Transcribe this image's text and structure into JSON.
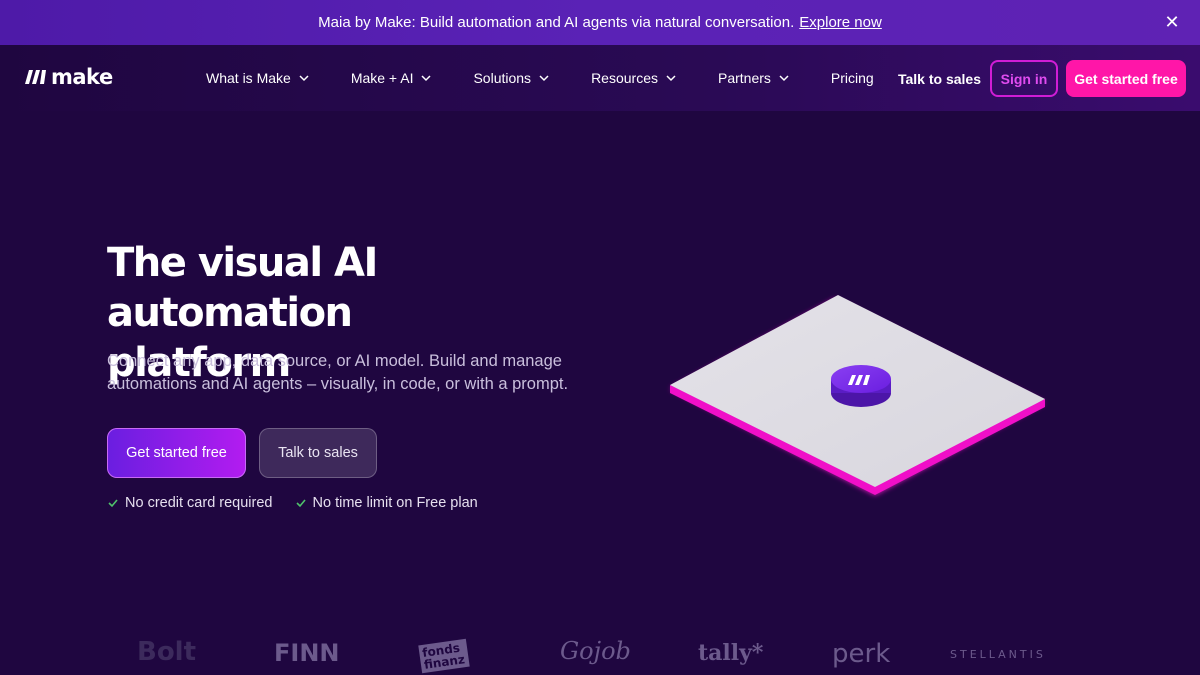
{
  "announcement": {
    "text": "Maia by Make: Build automation and AI agents via natural conversation.",
    "link": "Explore now",
    "close": "✕"
  },
  "header": {
    "logo": "make",
    "nav": [
      {
        "label": "What is Make"
      },
      {
        "label": "Make + AI"
      },
      {
        "label": "Solutions"
      },
      {
        "label": "Resources"
      },
      {
        "label": "Partners"
      },
      {
        "label": "Pricing"
      }
    ],
    "talk_to_sales": "Talk to sales",
    "sign_in": "Sign in",
    "get_started": "Get started free"
  },
  "hero": {
    "title_line1": "The visual AI automation",
    "title_line2": "platform",
    "subtitle_line1": "Connect any app, data source, or AI model. Build and manage",
    "subtitle_line2": "automations and AI agents – visually, in code, or with a prompt.",
    "primary_cta": "Get started free",
    "secondary_cta": "Talk to sales",
    "checks": [
      "No credit card required",
      "No time limit on Free plan"
    ]
  },
  "logos": [
    "Bolt",
    "FINN",
    "fonds finanz",
    "Gojob",
    "tally*",
    "perk",
    "STELLANTIS"
  ],
  "colors": {
    "background": "#1f0640",
    "announcement": "#5a22b6",
    "accent_pink": "#ff16a8",
    "accent_purple": "#6a1ee0"
  }
}
